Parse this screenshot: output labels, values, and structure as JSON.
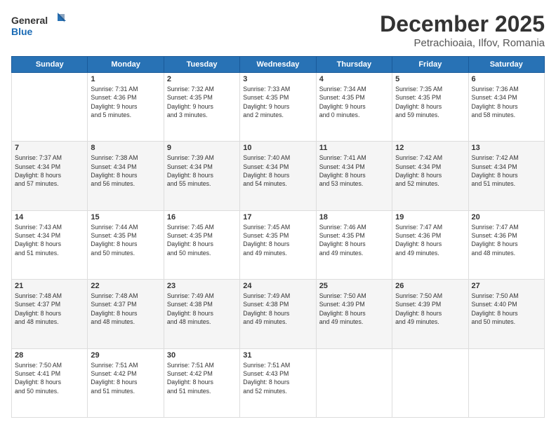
{
  "logo": {
    "line1": "General",
    "line2": "Blue"
  },
  "title": "December 2025",
  "subtitle": "Petrachioaia, Ilfov, Romania",
  "days_header": [
    "Sunday",
    "Monday",
    "Tuesday",
    "Wednesday",
    "Thursday",
    "Friday",
    "Saturday"
  ],
  "weeks": [
    [
      {
        "day": "",
        "info": ""
      },
      {
        "day": "1",
        "info": "Sunrise: 7:31 AM\nSunset: 4:36 PM\nDaylight: 9 hours\nand 5 minutes."
      },
      {
        "day": "2",
        "info": "Sunrise: 7:32 AM\nSunset: 4:35 PM\nDaylight: 9 hours\nand 3 minutes."
      },
      {
        "day": "3",
        "info": "Sunrise: 7:33 AM\nSunset: 4:35 PM\nDaylight: 9 hours\nand 2 minutes."
      },
      {
        "day": "4",
        "info": "Sunrise: 7:34 AM\nSunset: 4:35 PM\nDaylight: 9 hours\nand 0 minutes."
      },
      {
        "day": "5",
        "info": "Sunrise: 7:35 AM\nSunset: 4:35 PM\nDaylight: 8 hours\nand 59 minutes."
      },
      {
        "day": "6",
        "info": "Sunrise: 7:36 AM\nSunset: 4:34 PM\nDaylight: 8 hours\nand 58 minutes."
      }
    ],
    [
      {
        "day": "7",
        "info": "Sunrise: 7:37 AM\nSunset: 4:34 PM\nDaylight: 8 hours\nand 57 minutes."
      },
      {
        "day": "8",
        "info": "Sunrise: 7:38 AM\nSunset: 4:34 PM\nDaylight: 8 hours\nand 56 minutes."
      },
      {
        "day": "9",
        "info": "Sunrise: 7:39 AM\nSunset: 4:34 PM\nDaylight: 8 hours\nand 55 minutes."
      },
      {
        "day": "10",
        "info": "Sunrise: 7:40 AM\nSunset: 4:34 PM\nDaylight: 8 hours\nand 54 minutes."
      },
      {
        "day": "11",
        "info": "Sunrise: 7:41 AM\nSunset: 4:34 PM\nDaylight: 8 hours\nand 53 minutes."
      },
      {
        "day": "12",
        "info": "Sunrise: 7:42 AM\nSunset: 4:34 PM\nDaylight: 8 hours\nand 52 minutes."
      },
      {
        "day": "13",
        "info": "Sunrise: 7:42 AM\nSunset: 4:34 PM\nDaylight: 8 hours\nand 51 minutes."
      }
    ],
    [
      {
        "day": "14",
        "info": "Sunrise: 7:43 AM\nSunset: 4:34 PM\nDaylight: 8 hours\nand 51 minutes."
      },
      {
        "day": "15",
        "info": "Sunrise: 7:44 AM\nSunset: 4:35 PM\nDaylight: 8 hours\nand 50 minutes."
      },
      {
        "day": "16",
        "info": "Sunrise: 7:45 AM\nSunset: 4:35 PM\nDaylight: 8 hours\nand 50 minutes."
      },
      {
        "day": "17",
        "info": "Sunrise: 7:45 AM\nSunset: 4:35 PM\nDaylight: 8 hours\nand 49 minutes."
      },
      {
        "day": "18",
        "info": "Sunrise: 7:46 AM\nSunset: 4:35 PM\nDaylight: 8 hours\nand 49 minutes."
      },
      {
        "day": "19",
        "info": "Sunrise: 7:47 AM\nSunset: 4:36 PM\nDaylight: 8 hours\nand 49 minutes."
      },
      {
        "day": "20",
        "info": "Sunrise: 7:47 AM\nSunset: 4:36 PM\nDaylight: 8 hours\nand 48 minutes."
      }
    ],
    [
      {
        "day": "21",
        "info": "Sunrise: 7:48 AM\nSunset: 4:37 PM\nDaylight: 8 hours\nand 48 minutes."
      },
      {
        "day": "22",
        "info": "Sunrise: 7:48 AM\nSunset: 4:37 PM\nDaylight: 8 hours\nand 48 minutes."
      },
      {
        "day": "23",
        "info": "Sunrise: 7:49 AM\nSunset: 4:38 PM\nDaylight: 8 hours\nand 48 minutes."
      },
      {
        "day": "24",
        "info": "Sunrise: 7:49 AM\nSunset: 4:38 PM\nDaylight: 8 hours\nand 49 minutes."
      },
      {
        "day": "25",
        "info": "Sunrise: 7:50 AM\nSunset: 4:39 PM\nDaylight: 8 hours\nand 49 minutes."
      },
      {
        "day": "26",
        "info": "Sunrise: 7:50 AM\nSunset: 4:39 PM\nDaylight: 8 hours\nand 49 minutes."
      },
      {
        "day": "27",
        "info": "Sunrise: 7:50 AM\nSunset: 4:40 PM\nDaylight: 8 hours\nand 50 minutes."
      }
    ],
    [
      {
        "day": "28",
        "info": "Sunrise: 7:50 AM\nSunset: 4:41 PM\nDaylight: 8 hours\nand 50 minutes."
      },
      {
        "day": "29",
        "info": "Sunrise: 7:51 AM\nSunset: 4:42 PM\nDaylight: 8 hours\nand 51 minutes."
      },
      {
        "day": "30",
        "info": "Sunrise: 7:51 AM\nSunset: 4:42 PM\nDaylight: 8 hours\nand 51 minutes."
      },
      {
        "day": "31",
        "info": "Sunrise: 7:51 AM\nSunset: 4:43 PM\nDaylight: 8 hours\nand 52 minutes."
      },
      {
        "day": "",
        "info": ""
      },
      {
        "day": "",
        "info": ""
      },
      {
        "day": "",
        "info": ""
      }
    ]
  ]
}
